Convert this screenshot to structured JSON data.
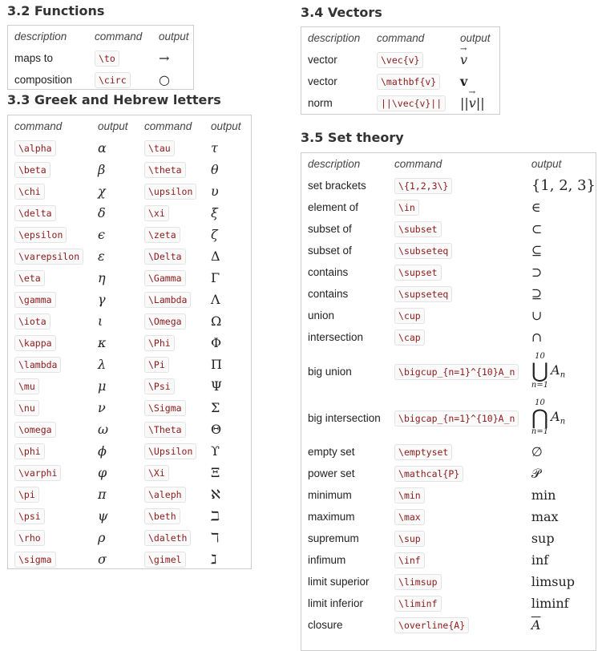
{
  "functions": {
    "heading": "3.2 Functions",
    "headers": [
      "description",
      "command",
      "output"
    ],
    "rows": [
      {
        "description": "maps to",
        "command": "\\to",
        "output": "→"
      },
      {
        "description": "composition",
        "command": "\\circ",
        "output": "○"
      }
    ]
  },
  "greek": {
    "heading": "3.3 Greek and Hebrew letters",
    "headers": [
      "command",
      "output",
      "command",
      "output"
    ],
    "rows": [
      [
        "\\alpha",
        "α",
        "\\tau",
        "τ"
      ],
      [
        "\\beta",
        "β",
        "\\theta",
        "θ"
      ],
      [
        "\\chi",
        "χ",
        "\\upsilon",
        "υ"
      ],
      [
        "\\delta",
        "δ",
        "\\xi",
        "ξ"
      ],
      [
        "\\epsilon",
        "ϵ",
        "\\zeta",
        "ζ"
      ],
      [
        "\\varepsilon",
        "ε",
        "\\Delta",
        "Δ"
      ],
      [
        "\\eta",
        "η",
        "\\Gamma",
        "Γ"
      ],
      [
        "\\gamma",
        "γ",
        "\\Lambda",
        "Λ"
      ],
      [
        "\\iota",
        "ι",
        "\\Omega",
        "Ω"
      ],
      [
        "\\kappa",
        "κ",
        "\\Phi",
        "Φ"
      ],
      [
        "\\lambda",
        "λ",
        "\\Pi",
        "Π"
      ],
      [
        "\\mu",
        "μ",
        "\\Psi",
        "Ψ"
      ],
      [
        "\\nu",
        "ν",
        "\\Sigma",
        "Σ"
      ],
      [
        "\\omega",
        "ω",
        "\\Theta",
        "Θ"
      ],
      [
        "\\phi",
        "ϕ",
        "\\Upsilon",
        "ϒ"
      ],
      [
        "\\varphi",
        "φ",
        "\\Xi",
        "Ξ"
      ],
      [
        "\\pi",
        "π",
        "\\aleph",
        "ℵ"
      ],
      [
        "\\psi",
        "ψ",
        "\\beth",
        "ℶ"
      ],
      [
        "\\rho",
        "ρ",
        "\\daleth",
        "ℸ"
      ],
      [
        "\\sigma",
        "σ",
        "\\gimel",
        "ℷ"
      ]
    ]
  },
  "vectors": {
    "heading": "3.4 Vectors",
    "headers": [
      "description",
      "command",
      "output"
    ],
    "rows": [
      {
        "description": "vector",
        "command": "\\vec{v}",
        "output": "v"
      },
      {
        "description": "vector",
        "command": "\\mathbf{v}",
        "output": "v"
      },
      {
        "description": "norm",
        "command": "||\\vec{v}||",
        "output": "v"
      }
    ]
  },
  "sets": {
    "heading": "3.5 Set theory",
    "headers": [
      "description",
      "command",
      "output"
    ],
    "rows": [
      {
        "description": "set brackets",
        "command": "\\{1,2,3\\}",
        "output": "{1, 2, 3}"
      },
      {
        "description": "element of",
        "command": "\\in",
        "output": "∈"
      },
      {
        "description": "subset of",
        "command": "\\subset",
        "output": "⊂"
      },
      {
        "description": "subset of",
        "command": "\\subseteq",
        "output": "⊆"
      },
      {
        "description": "contains",
        "command": "\\supset",
        "output": "⊃"
      },
      {
        "description": "contains",
        "command": "\\supseteq",
        "output": "⊇"
      },
      {
        "description": "union",
        "command": "\\cup",
        "output": "∪"
      },
      {
        "description": "intersection",
        "command": "\\cap",
        "output": "∩"
      },
      {
        "description": "big union",
        "command": "\\bigcup_{n=1}^{10}A_n",
        "output": "⋃",
        "upper": "10",
        "lower": "n=1",
        "term": "A",
        "sub": "n"
      },
      {
        "description": "big intersection",
        "command": "\\bigcap_{n=1}^{10}A_n",
        "output": "⋂",
        "upper": "10",
        "lower": "n=1",
        "term": "A",
        "sub": "n"
      },
      {
        "description": "empty set",
        "command": "\\emptyset",
        "output": "∅"
      },
      {
        "description": "power set",
        "command": "\\mathcal{P}",
        "output": "𝒫"
      },
      {
        "description": "minimum",
        "command": "\\min",
        "output": "min"
      },
      {
        "description": "maximum",
        "command": "\\max",
        "output": "max"
      },
      {
        "description": "supremum",
        "command": "\\sup",
        "output": "sup"
      },
      {
        "description": "infimum",
        "command": "\\inf",
        "output": "inf"
      },
      {
        "description": "limit superior",
        "command": "\\limsup",
        "output": "limsup"
      },
      {
        "description": "limit inferior",
        "command": "\\liminf",
        "output": "liminf"
      },
      {
        "description": "closure",
        "command": "\\overline{A}",
        "output": "A"
      }
    ]
  }
}
